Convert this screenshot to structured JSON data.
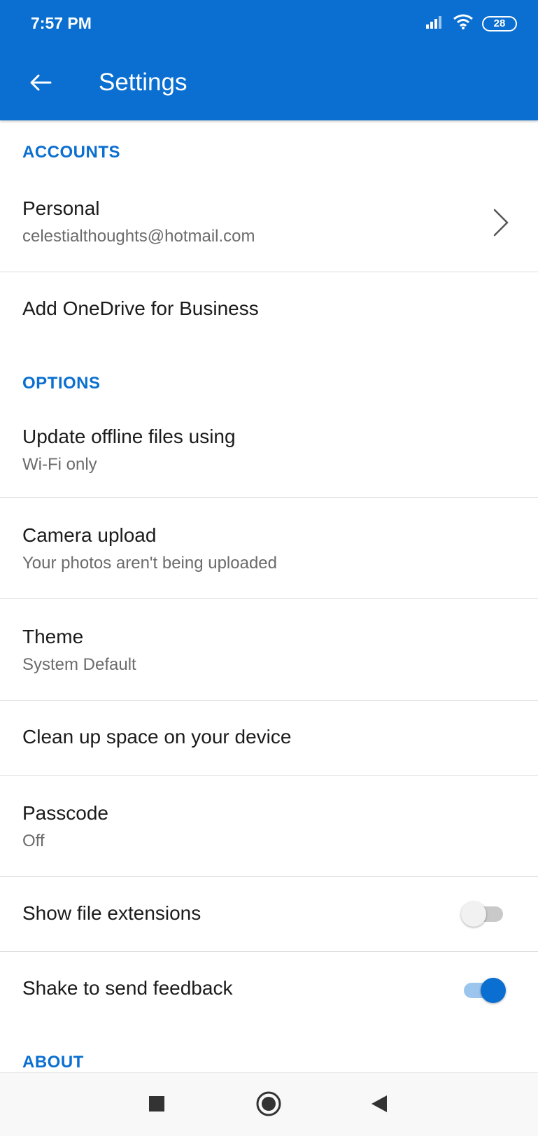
{
  "status_bar": {
    "time": "7:57 PM",
    "battery": "28",
    "icons": [
      "signal-icon",
      "wifi-icon",
      "battery-icon"
    ]
  },
  "app_bar": {
    "title": "Settings",
    "back_icon": "arrow-left-icon"
  },
  "sections": {
    "accounts": {
      "header": "ACCOUNTS",
      "personal": {
        "title": "Personal",
        "subtitle": "celestialthoughts@hotmail.com"
      },
      "add_business": {
        "title": "Add OneDrive for Business"
      }
    },
    "options": {
      "header": "OPTIONS",
      "offline": {
        "title": "Update offline files using",
        "subtitle": "Wi-Fi only"
      },
      "camera": {
        "title": "Camera upload",
        "subtitle": "Your photos aren't being uploaded"
      },
      "theme": {
        "title": "Theme",
        "subtitle": "System Default"
      },
      "cleanup": {
        "title": "Clean up space on your device"
      },
      "passcode": {
        "title": "Passcode",
        "subtitle": "Off"
      },
      "file_ext": {
        "title": "Show file extensions",
        "enabled": false
      },
      "shake": {
        "title": "Shake to send feedback",
        "enabled": true
      }
    },
    "about": {
      "header": "ABOUT"
    }
  },
  "nav_bar": {
    "icons": [
      "recents-square-icon",
      "home-circle-icon",
      "back-triangle-icon"
    ]
  },
  "colors": {
    "accent": "#0a6fd0",
    "text_primary": "#1b1b1b",
    "text_secondary": "#6b6b6b",
    "divider": "#dcdcdc"
  }
}
